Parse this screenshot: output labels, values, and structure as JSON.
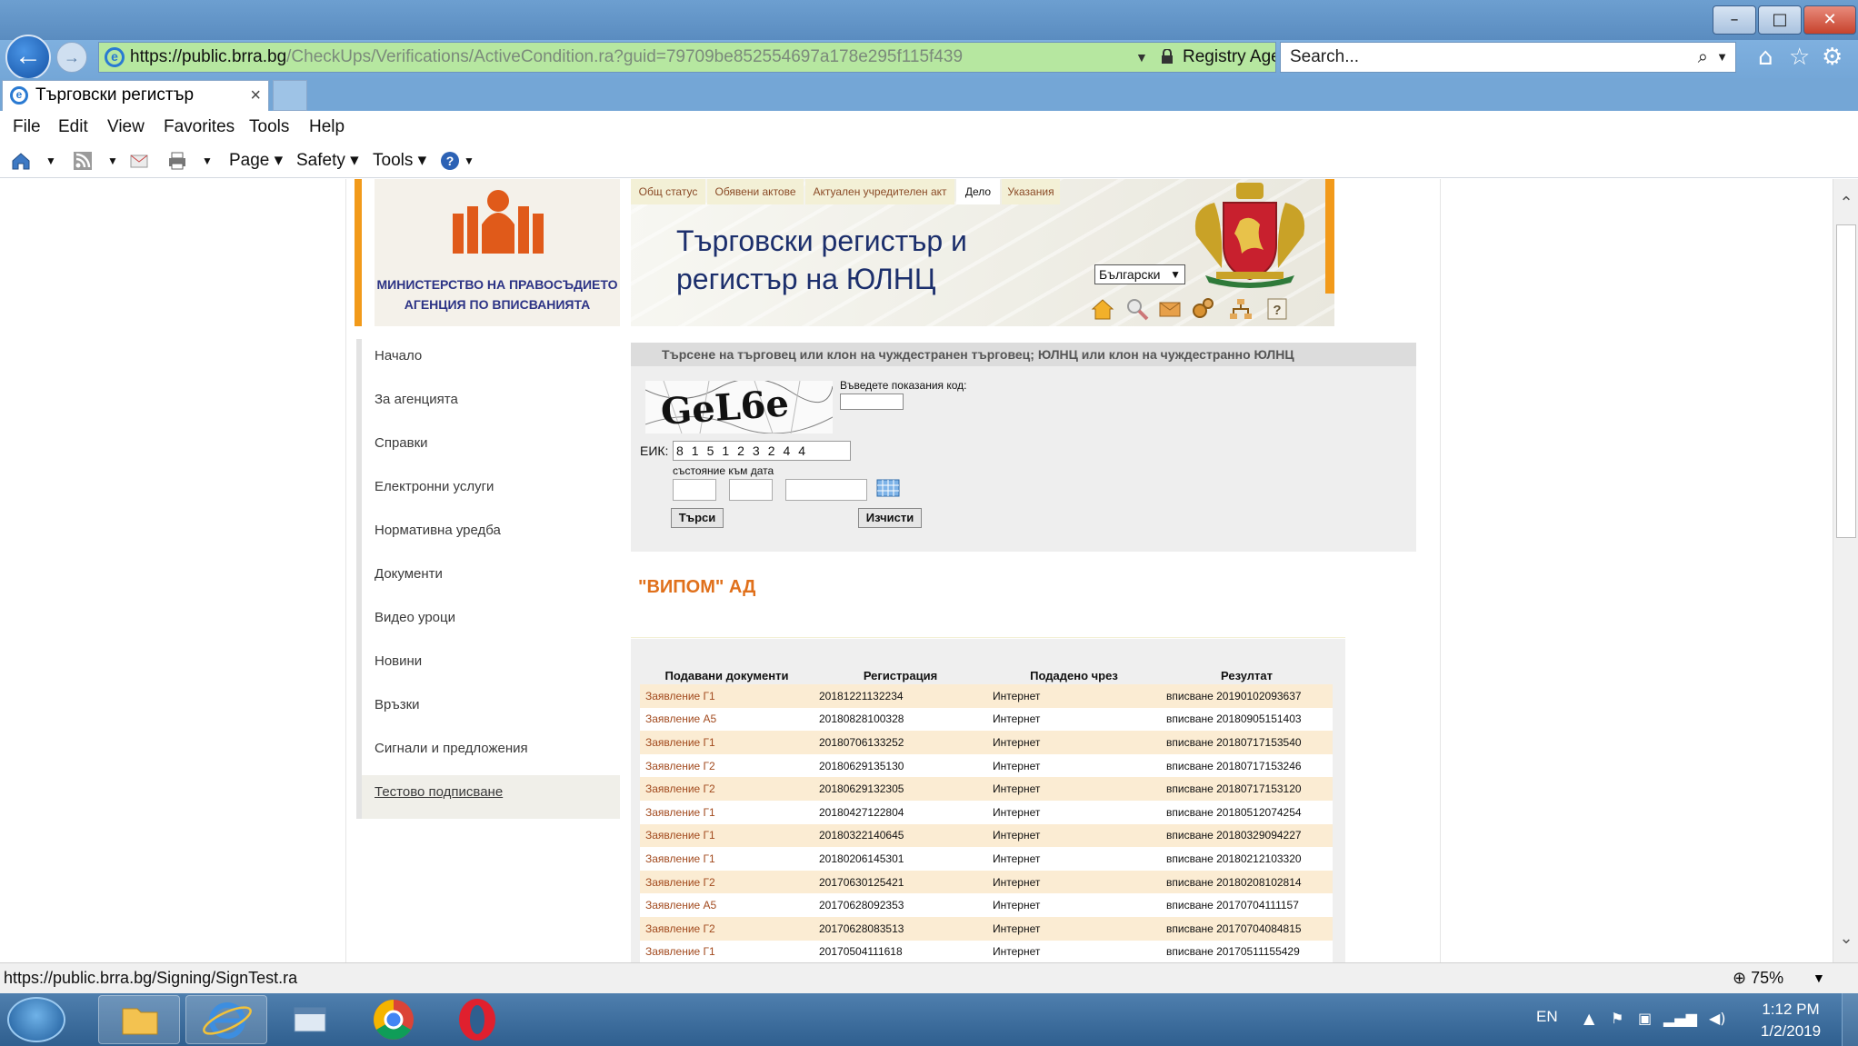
{
  "browser": {
    "url_scheme": "https://",
    "url_host": "public.brra.bg",
    "url_path": "/CheckUps/Verifications/ActiveCondition.ra?guid=79709be852554697a178e295f115f439",
    "site_identity": "Registry Agency [BG]",
    "search_placeholder": "Search...",
    "tab_title": "Търговски регистър",
    "menu": [
      "File",
      "Edit",
      "View",
      "Favorites",
      "Tools",
      "Help"
    ],
    "commands": {
      "page": "Page ▾",
      "safety": "Safety ▾",
      "tools": "Tools ▾"
    },
    "status_url": "https://public.brra.bg/Signing/SignTest.ra",
    "zoom": "75%"
  },
  "header": {
    "ministry_line1": "МИНИСТЕРСТВО НА ПРАВОСЪДИЕТО",
    "ministry_line2": "АГЕНЦИЯ ПО ВПИСВАНИЯТА",
    "title_line1": "Търговски регистър и",
    "title_line2": "регистър на ЮЛНЦ",
    "language": "Български"
  },
  "nav": [
    "Начало",
    "За агенцията",
    "Справки",
    "Електронни услуги",
    "Нормативна уредба",
    "Документи",
    "Видео уроци",
    "Новини",
    "Връзки",
    "Сигнали и предложения",
    "Тестово подписване"
  ],
  "search": {
    "header": "Търсене на търговец или клон на чуждестранен търговец; ЮЛНЦ или клон на чуждестранно ЮЛНЦ",
    "captcha_text": "GeL6e",
    "captcha_label": "Въведете показания код:",
    "eik_label": "ЕИК:",
    "eik_value": "815123244",
    "date_label": "състояние към дата",
    "search_button": "Търси",
    "clear_button": "Изчисти"
  },
  "company": {
    "name": "\"ВИПОМ\" АД",
    "tabs": [
      "Общ статус",
      "Обявени актове",
      "Актуален учредителен акт",
      "Дело",
      "Указания"
    ],
    "active_tab": "Дело"
  },
  "documents": {
    "columns": [
      "Подавани документи",
      "Регистрация",
      "Подадено чрез",
      "Резултат"
    ],
    "rows": [
      [
        "Заявление Г1",
        "20181221132234",
        "Интернет",
        "вписване 20190102093637"
      ],
      [
        "Заявление А5",
        "20180828100328",
        "Интернет",
        "вписване 20180905151403"
      ],
      [
        "Заявление Г1",
        "20180706133252",
        "Интернет",
        "вписване 20180717153540"
      ],
      [
        "Заявление Г2",
        "20180629135130",
        "Интернет",
        "вписване 20180717153246"
      ],
      [
        "Заявление Г2",
        "20180629132305",
        "Интернет",
        "вписване 20180717153120"
      ],
      [
        "Заявление Г1",
        "20180427122804",
        "Интернет",
        "вписване 20180512074254"
      ],
      [
        "Заявление Г1",
        "20180322140645",
        "Интернет",
        "вписване 20180329094227"
      ],
      [
        "Заявление Г1",
        "20180206145301",
        "Интернет",
        "вписване 20180212103320"
      ],
      [
        "Заявление Г2",
        "20170630125421",
        "Интернет",
        "вписване 20180208102814"
      ],
      [
        "Заявление А5",
        "20170628092353",
        "Интернет",
        "вписване 20170704111157"
      ],
      [
        "Заявление Г2",
        "20170628083513",
        "Интернет",
        "вписване 20170704084815"
      ],
      [
        "Заявление Г1",
        "20170504111618",
        "Интернет",
        "вписване 20170511155429"
      ]
    ]
  },
  "taskbar": {
    "language": "EN",
    "time": "1:12 PM",
    "date": "1/2/2019"
  },
  "colors": {
    "accent_orange": "#f29a1a",
    "company_name": "#e0701b",
    "title_blue": "#1c2f6c",
    "row_highlight": "#fbecd3"
  }
}
